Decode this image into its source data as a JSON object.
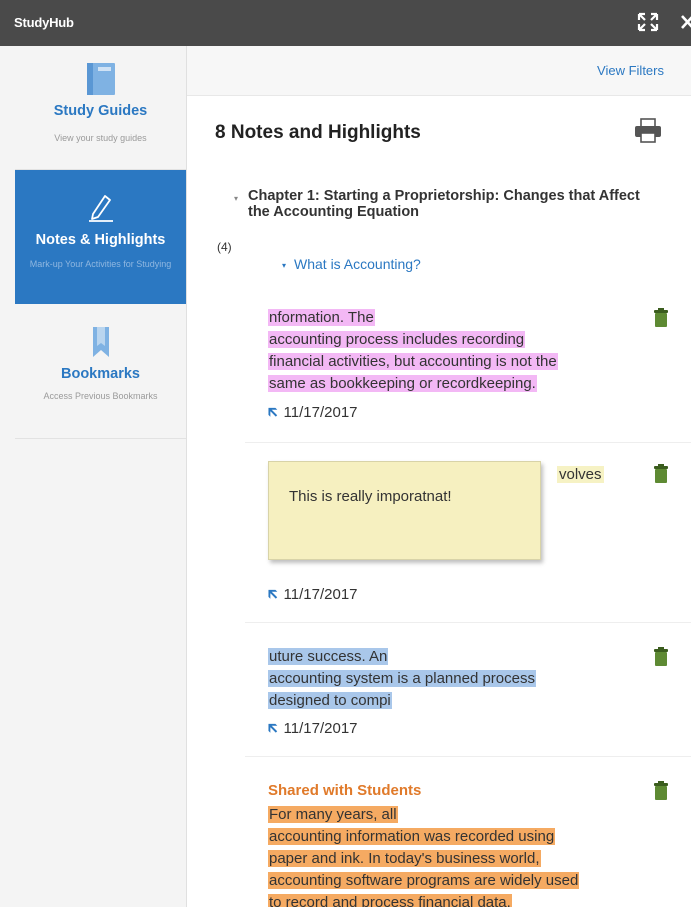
{
  "window": {
    "title": "StudyHub"
  },
  "sidebar": {
    "items": [
      {
        "label": "Study Guides",
        "subtitle": "View your study guides",
        "icon": "study-guide-icon",
        "active": false
      },
      {
        "label": "Notes & Highlights",
        "subtitle": "Mark-up Your Activities for Studying",
        "icon": "pencil-icon",
        "active": true
      },
      {
        "label": "Bookmarks",
        "subtitle": "Access Previous Bookmarks",
        "icon": "bookmark-icon",
        "active": false
      }
    ]
  },
  "main": {
    "view_filters": "View Filters",
    "title": "8 Notes and Highlights",
    "chapter": "Chapter 1: Starting a Proprietorship: Changes that Affect the Accounting Equation",
    "count": "(4)",
    "section": "What is Accounting?",
    "notes": [
      {
        "lines": [
          "nformation. The",
          "accounting process includes recording",
          "financial activities, but accounting is not the",
          "same as bookkeeping or recordkeeping."
        ],
        "date": "11/17/2017",
        "color": "#f3b8f5"
      },
      {
        "sticky": "This is really imporatnat!",
        "snippet": "volves",
        "date": "11/17/2017",
        "color": "#f6f2c4"
      },
      {
        "lines": [
          "uture success. An",
          "accounting system is a planned process",
          "designed to compi"
        ],
        "date": "11/17/2017",
        "color": "#a9c7ea"
      },
      {
        "label": "Shared with Students",
        "lines": [
          "For many years, all",
          "accounting information was recorded using",
          "paper and ink. In today's business world,",
          "accounting software programs are widely used",
          "to record and process financial data."
        ],
        "color": "#f5aa62"
      }
    ]
  },
  "colors": {
    "accent": "#2b78c2",
    "titlebar": "#4a4a4a",
    "shared": "#e07a2a"
  }
}
